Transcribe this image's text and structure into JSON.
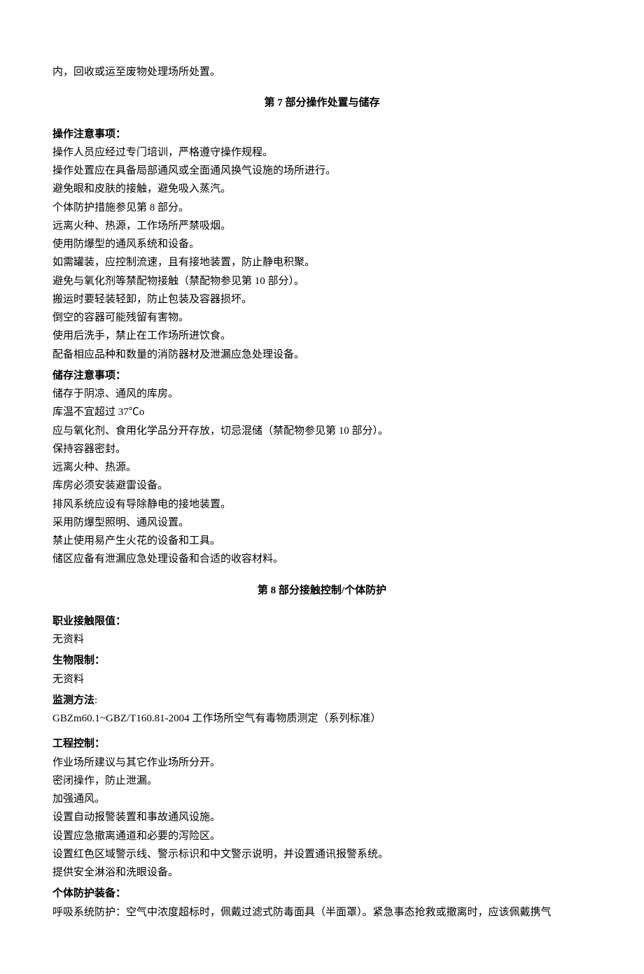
{
  "intro_fragment": "内，回收或运至废物处理场所处置。",
  "section7": {
    "title": "第 7 部分操作处置与储存",
    "handling_heading": "操作注意事项：",
    "handling_lines": [
      "操作人员应经过专门培训，严格遵守操作规程。",
      "操作处置应在具备局部通风或全面通风换气设施的场所进行。",
      "避免眼和皮肤的接触，避免吸入蒸汽。",
      "个体防护措施参见第 8 部分。",
      "远离火种、热源，工作场所严禁吸烟。",
      "使用防爆型的通风系统和设备。",
      "如需罐装，应控制流速，且有接地装置，防止静电积聚。",
      "避免与氧化剂等禁配物接触（禁配物参见第 10 部分）。",
      "搬运时要轻装轻卸，防止包装及容器损坏。",
      "倒空的容器可能残留有害物。",
      "使用后洗手，禁止在工作场所进饮食。",
      "配备相应品种和数量的消防器材及泄漏应急处理设备。"
    ],
    "storage_heading": "储存注意事项：",
    "storage_lines": [
      "储存于阴凉、通风的库房。",
      "库温不宜超过 37℃o",
      "应与氧化剂、食用化学品分开存放，切忌混储（禁配物参见第 10 部分）。",
      "保持容器密封。",
      "远离火种、热源。",
      "库房必须安装避雷设备。",
      "排风系统应设有导除静电的接地装置。",
      "采用防爆型照明、通风设置。",
      "禁止使用易产生火花的设备和工具。",
      "储区应备有泄漏应急处理设备和合适的收容材料。"
    ]
  },
  "section8": {
    "title": "第 8 部分接触控制/个体防护",
    "occ_limit_heading": "职业接触限值：",
    "occ_limit_value": "无资料",
    "bio_limit_heading": "生物限制：",
    "bio_limit_value": "无资料",
    "monitor_heading": "监测方法",
    "monitor_colon": ":",
    "monitor_value": "GBZm60.1~GBZ/T160.81-2004 工作场所空气有毒物质测定（系列标准）",
    "eng_control_heading": "工程控制：",
    "eng_control_lines": [
      "作业场所建议与其它作业场所分开。",
      "密闭操作，防止泄漏。",
      "加强通风。",
      "设置自动报警装置和事故通风设施。",
      "设置应急撤离通道和必要的泻险区。",
      "设置红色区域警示线、警示标识和中文警示说明，并设置通讯报警系统。",
      "提供安全淋浴和洗眼设备。"
    ],
    "ppe_heading": "个体防护装备：",
    "ppe_line": "呼吸系统防护：空气中浓度超标时，佩戴过滤式防毒面具（半面罩）。紧急事态抢救或撤离时，应该佩戴携气"
  }
}
